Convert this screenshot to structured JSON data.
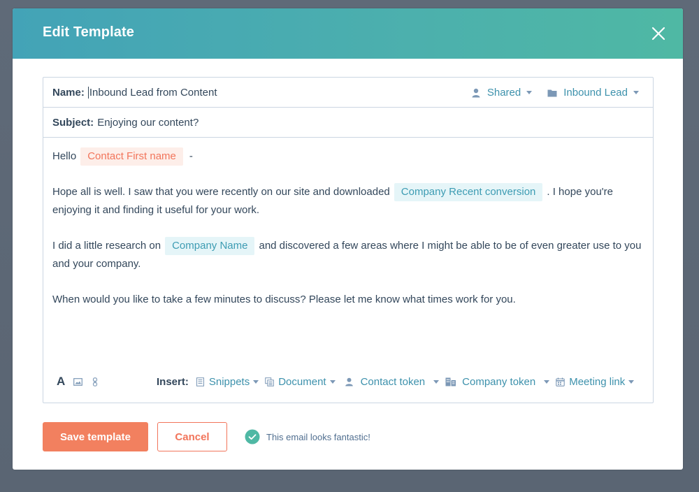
{
  "modal": {
    "title": "Edit Template",
    "close_icon": "close-icon"
  },
  "template": {
    "name_label": "Name:",
    "name_value": "Inbound Lead from Content",
    "subject_label": "Subject:",
    "subject_value": "Enjoying our content?",
    "sharing": {
      "icon": "person-icon",
      "label": "Shared"
    },
    "folder": {
      "icon": "folder-icon",
      "label": "Inbound Lead"
    }
  },
  "body": {
    "p1": {
      "before": "Hello",
      "token": "Contact First name",
      "after": "-"
    },
    "p2": {
      "before": "Hope all is well. I saw that you were recently on our site and downloaded",
      "token": "Company Recent conversion",
      "after": ". I hope you're enjoying it and finding it useful for your work."
    },
    "p3": {
      "before": "I did a little research on",
      "token": "Company Name",
      "after": "and discovered a few areas where I might be able to be of even greater use to you and your company."
    },
    "p4": "When would you like to take a few minutes to discuss? Please let me know what times work for you."
  },
  "toolbar": {
    "format_icons": [
      "text-format-icon",
      "image-icon",
      "link-icon"
    ],
    "text_format_glyph": "A",
    "insert_label": "Insert:",
    "insert_items": [
      {
        "icon": "snippet-icon",
        "label": "Snippets"
      },
      {
        "icon": "document-icon",
        "label": "Document"
      },
      {
        "icon": "person-icon",
        "label": "Contact token"
      },
      {
        "icon": "building-icon",
        "label": "Company token"
      },
      {
        "icon": "calendar-icon",
        "label": "Meeting link"
      }
    ]
  },
  "footer": {
    "save_label": "Save template",
    "cancel_label": "Cancel",
    "status_icon": "check-circle-icon",
    "status_text": "This email looks fantastic!"
  },
  "colors": {
    "header_gradient_start": "#43a3b7",
    "header_gradient_end": "#4fb8a4",
    "primary": "#f2805f",
    "link": "#3d91ac",
    "contact_token_bg": "#fdeee9",
    "company_token_bg": "#e5f5f8",
    "success": "#4fb8a4",
    "overlay": "#5c6775"
  }
}
